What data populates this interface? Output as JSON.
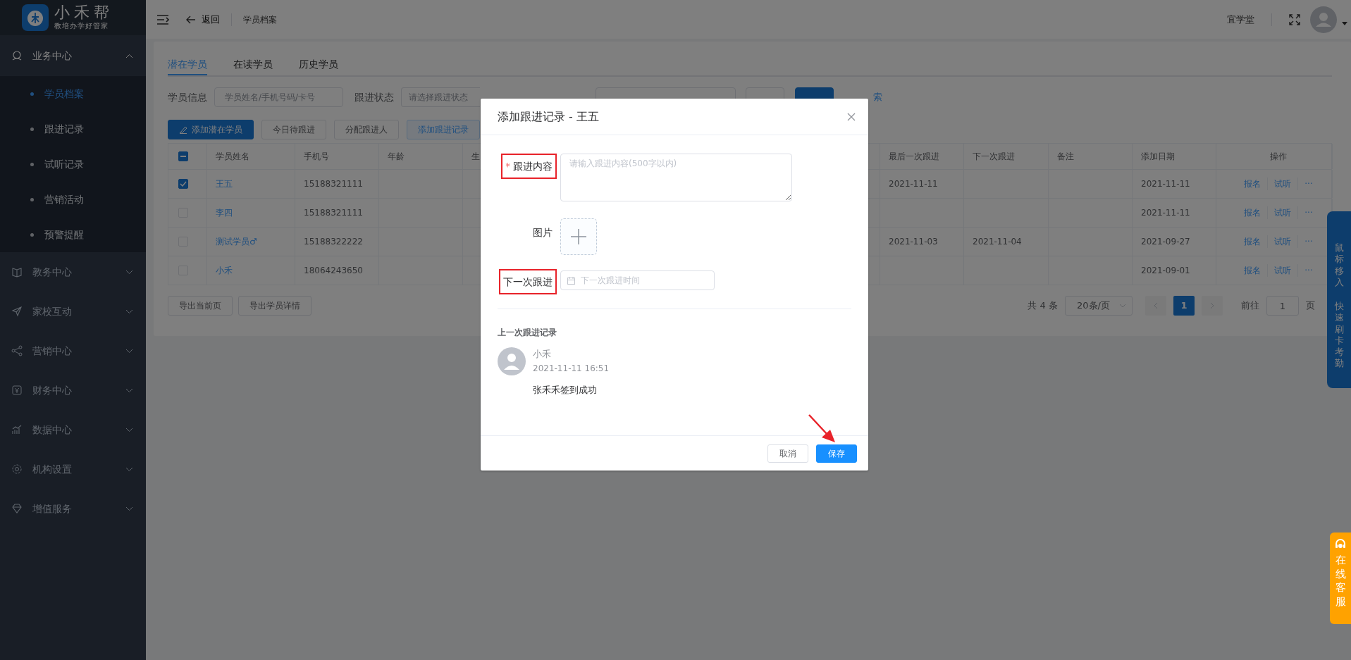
{
  "sidebar": {
    "logo_title": "小禾帮",
    "logo_subtitle": "教培办学好管家",
    "items": [
      {
        "label": "业务中心",
        "expanded": true,
        "children": [
          {
            "label": "学员档案",
            "selected": true
          },
          {
            "label": "跟进记录",
            "selected": false
          },
          {
            "label": "试听记录",
            "selected": false
          },
          {
            "label": "营销活动",
            "selected": false
          },
          {
            "label": "预警提醒",
            "selected": false
          }
        ]
      },
      {
        "label": "教务中心",
        "expanded": false
      },
      {
        "label": "家校互动",
        "expanded": false
      },
      {
        "label": "营销中心",
        "expanded": false
      },
      {
        "label": "财务中心",
        "expanded": false
      },
      {
        "label": "数据中心",
        "expanded": false
      },
      {
        "label": "机构设置",
        "expanded": false
      },
      {
        "label": "增值服务",
        "expanded": false
      }
    ]
  },
  "header": {
    "back": "返回",
    "breadcrumb": "学员档案",
    "org": "宜学堂"
  },
  "tabs": [
    {
      "label": "潜在学员",
      "selected": true
    },
    {
      "label": "在读学员",
      "selected": false
    },
    {
      "label": "历史学员",
      "selected": false
    }
  ],
  "filters": [
    {
      "label": "学员信息",
      "placeholder": "学员姓名/手机号码/卡号"
    },
    {
      "label": "跟进状态",
      "placeholder": "请选择跟进状态"
    }
  ],
  "search_link": "索",
  "toolbar": [
    {
      "label": "添加潜在学员",
      "kind": "primary"
    },
    {
      "label": "今日待跟进",
      "kind": "default"
    },
    {
      "label": "分配跟进人",
      "kind": "default"
    },
    {
      "label": "添加跟进记录",
      "kind": "light"
    }
  ],
  "table": {
    "select_all_indeterminate": true,
    "columns": [
      "学员姓名",
      "手机号",
      "年龄",
      "生",
      "最后一次跟进",
      "下一次跟进",
      "备注",
      "添加日期",
      "操作"
    ],
    "rows": [
      {
        "selected": true,
        "name": "王五",
        "phone": "15188321111",
        "last_follow": "2021-11-11",
        "added": "2021-11-11",
        "actions": [
          "报名",
          "试听",
          "···"
        ]
      },
      {
        "selected": false,
        "name": "李四",
        "phone": "15188321111",
        "added": "2021-11-11",
        "actions": [
          "报名",
          "试听",
          "···"
        ]
      },
      {
        "selected": false,
        "name": "测试学员♂",
        "phone": "15188322222",
        "last_follow": "2021-11-03",
        "next_follow": "2021-11-04",
        "added": "2021-09-27",
        "actions": [
          "报名",
          "试听",
          "···"
        ]
      },
      {
        "selected": false,
        "name": "小禾",
        "phone": "18064243650",
        "added": "2021-09-01",
        "actions": [
          "报名",
          "试听",
          "···"
        ]
      }
    ]
  },
  "export_buttons": [
    "导出当前页",
    "导出学员详情"
  ],
  "pagination": {
    "total": "共 4 条",
    "page_size": "20条/页",
    "pages": [
      {
        "label": "1",
        "selected": true
      }
    ],
    "goto_label": "前往",
    "goto_value": "1",
    "goto_suffix": "页"
  },
  "modal": {
    "title": "添加跟进记录 - 王五",
    "fields": [
      {
        "kind": "textarea",
        "label": "跟进内容",
        "required_mark": "*",
        "highlighted": true,
        "placeholder": "请输入跟进内容(500字以内)"
      },
      {
        "kind": "upload",
        "label": "图片",
        "highlighted": false
      },
      {
        "kind": "date",
        "label": "下一次跟进",
        "highlighted": true,
        "placeholder": "下一次跟进时间"
      }
    ],
    "history_title": "上一次跟进记录",
    "history": [
      {
        "author": "小禾",
        "time": "2021-11-11 16:51",
        "content": "张禾禾签到成功"
      }
    ],
    "buttons": [
      {
        "label": "取消",
        "kind": "default",
        "pointed_at": false
      },
      {
        "label": "保存",
        "kind": "primary",
        "pointed_at": true
      }
    ]
  },
  "side_tabs": {
    "attendance": [
      "鼠标移入",
      "快速刷卡考勤"
    ],
    "service": "在线客服"
  }
}
